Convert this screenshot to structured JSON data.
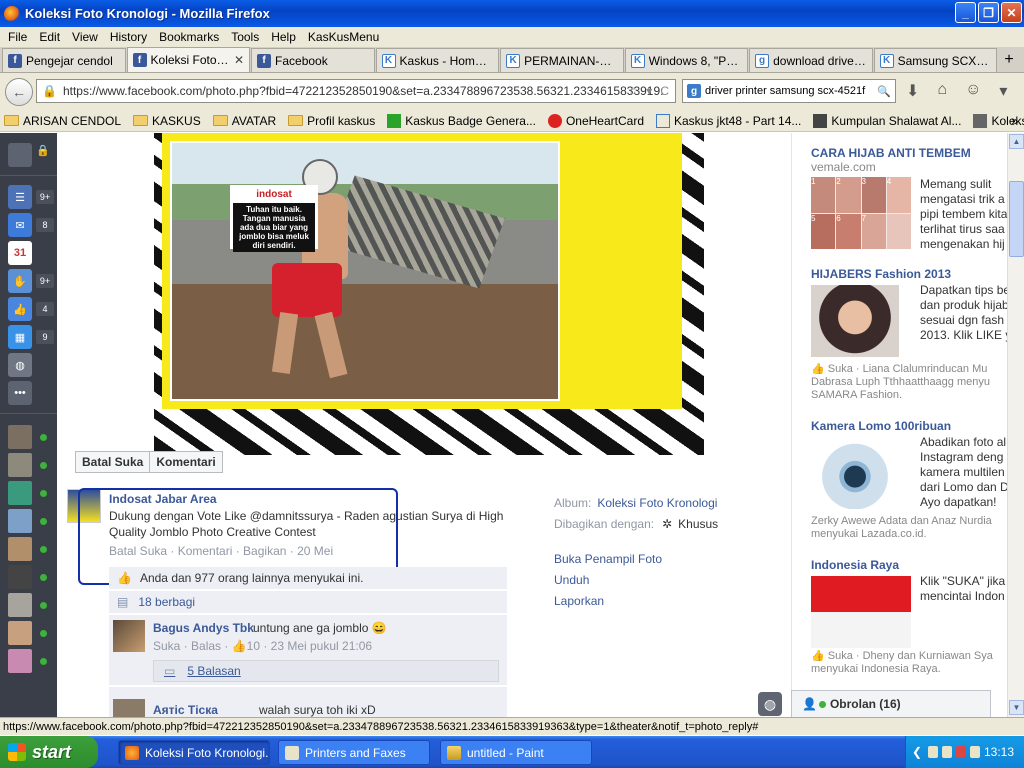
{
  "window": {
    "title": "Koleksi Foto Kronologi - Mozilla Firefox",
    "controls": {
      "minimize": "_",
      "maximize": "❐",
      "close": "✕"
    }
  },
  "menu": [
    "File",
    "Edit",
    "View",
    "History",
    "Bookmarks",
    "Tools",
    "Help",
    "KasKusMenu"
  ],
  "tabs": [
    {
      "label": "Pengejar cendol",
      "icon": "facebook-icon",
      "icon_glyph": "f",
      "icon_class": "fb"
    },
    {
      "label": "Koleksi Foto Kr...",
      "icon": "facebook-icon",
      "icon_glyph": "f",
      "icon_class": "fb",
      "active": true,
      "close": "✕"
    },
    {
      "label": "Facebook",
      "icon": "facebook-icon",
      "icon_glyph": "f",
      "icon_class": "fb"
    },
    {
      "label": "Kaskus - Home Lo...",
      "icon": "kaskus-icon",
      "icon_glyph": "K",
      "icon_class": "k"
    },
    {
      "label": "PERMAINAN-PER...",
      "icon": "kaskus-icon",
      "icon_glyph": "K",
      "icon_class": "k"
    },
    {
      "label": "Windows 8, \"Palin...",
      "icon": "kaskus-icon",
      "icon_glyph": "K",
      "icon_class": "k"
    },
    {
      "label": "download driver p...",
      "icon": "google-icon",
      "icon_glyph": "g",
      "icon_class": "g"
    },
    {
      "label": "Samsung SCX-452...",
      "icon": "kaskus-icon",
      "icon_glyph": "K",
      "icon_class": "k"
    }
  ],
  "new_tab": "+",
  "nav": {
    "back": "←",
    "url": "https://www.facebook.com/photo.php?fbid=472212352850190&set=a.233478896723538.56321.2334615833919:",
    "url_star": "☆",
    "url_down": "▾",
    "url_reload": "C",
    "search_engine": "g",
    "search_text": "driver printer samsung scx-4521f",
    "search_icon": "🔍",
    "download": "⬇",
    "home": "⌂",
    "addon": "☺",
    "menu": "▾"
  },
  "bookmarks": [
    {
      "label": "ARISAN CENDOL",
      "type": "folder"
    },
    {
      "label": "KASKUS",
      "type": "folder"
    },
    {
      "label": "AVATAR",
      "type": "folder"
    },
    {
      "label": "Profil kaskus",
      "type": "folder"
    },
    {
      "label": "Kaskus Badge Genera...",
      "type": "site",
      "color": "#29a329"
    },
    {
      "label": "OneHeartCard",
      "type": "site",
      "color": "#d22"
    },
    {
      "label": "Kaskus jkt48 - Part 14...",
      "type": "site",
      "color": "#3b7bc8"
    },
    {
      "label": "Kumpulan Shalawat Al...",
      "type": "site",
      "color": "#444"
    },
    {
      "label": "Koleksi Album Mp3 Sh...",
      "type": "site",
      "color": "#666"
    }
  ],
  "bookmarks_more": "»",
  "fb_sidebar": {
    "badges": [
      "9+",
      "8",
      "9+",
      "4",
      "9"
    ],
    "calendar_day": "31",
    "more": "•••",
    "globe": "◍"
  },
  "photo": {
    "sign_brand": "indosat",
    "sign_text": "Tuhan itu baik. Tangan manusia ada dua biar yang jomblo bisa meluk diri sendiri."
  },
  "photo_actions": {
    "unlike": "Batal Suka",
    "comment": "Komentari"
  },
  "post": {
    "owner": "Indosat Jabar Area",
    "text": "Dukung dengan Vote Like @damnitssurya - Raden agustian Surya di High Quality Jomblo Photo Creative Contest",
    "meta": "Batal Suka · Komentari · Bagikan · 20 Mei",
    "likes": "Anda dan 977 orang lainnya menyukai ini.",
    "shares": "18 berbagi",
    "comments": [
      {
        "author": "Bagus Andys Tbk",
        "text": "untung ane ga jomblo 😄",
        "meta": "Suka · Balas · 👍10 · 23 Mei pukul 21:06",
        "replies": "5 Balasan"
      },
      {
        "author": "Аятіс Тіска",
        "text": "walah surya toh iki xD"
      }
    ]
  },
  "album": {
    "album_label": "Album:",
    "album_value": "Koleksi Foto Kronologi",
    "shared_label": "Dibagikan dengan:",
    "shared_value": "Khusus",
    "links": [
      "Buka Penampil Foto",
      "Unduh",
      "Laporkan"
    ]
  },
  "ads": [
    {
      "title": "CARA HIJAB ANTI TEMBEM",
      "domain": "vemale.com",
      "text": [
        "Memang sulit",
        "mengatasi trik a",
        "pipi tembem kita",
        "terlihat tirus saa",
        "mengenakan hij"
      ]
    },
    {
      "title": "HIJABERS Fashion 2013",
      "text": [
        "Dapatkan tips be",
        "dan produk hijab",
        "sesuai dgn fash",
        "2013. Klik LIKE y"
      ],
      "social": [
        "Suka · Liana Clalumrinducan Mu",
        "Dabrasa Luph Tthhaatthaagg menyu",
        "SAMARA Fashion."
      ]
    },
    {
      "title": "Kamera Lomo 100ribuan",
      "text": [
        "Abadikan foto al",
        "Instagram deng",
        "kamera multilen",
        "dari Lomo dan D",
        "Ayo dapatkan!"
      ],
      "social": [
        "Zerky Awewe Adata dan Anaz Nurdia",
        "menyukai Lazada.co.id."
      ]
    },
    {
      "title": "Indonesia Raya",
      "text": [
        "Klik \"SUKA\" jika",
        "mencintai Indon"
      ],
      "social": [
        "Suka · Dheny dan Kurniawan Sya",
        "menyukai Indonesia Raya."
      ]
    }
  ],
  "ad_img_labels": [
    "1",
    "2",
    "3",
    "4",
    "5",
    "6",
    "7"
  ],
  "chat": {
    "label": "Obrolan (16)"
  },
  "status_url": "https://www.facebook.com/photo.php?fbid=472212352850190&set=a.233478896723538.56321.2334615833919363&type=1&theater&notif_t=photo_reply#",
  "taskbar": {
    "start": "start",
    "tasks": [
      "Koleksi Foto Kronologi...",
      "Printers and Faxes",
      "untitled - Paint"
    ],
    "clock": "13:13",
    "tray_arrow": "❮"
  }
}
